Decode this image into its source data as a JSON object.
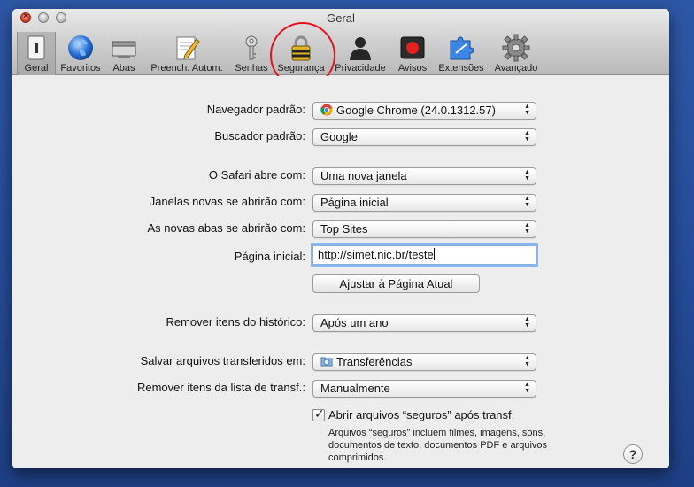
{
  "window": {
    "title": "Geral"
  },
  "toolbar": [
    {
      "label": "Geral",
      "icon": "general-switch-icon",
      "selected": true
    },
    {
      "label": "Favoritos",
      "icon": "globe-icon"
    },
    {
      "label": "Abas",
      "icon": "tabs-icon"
    },
    {
      "label": "Preench. Autom.",
      "icon": "autofill-pencil-icon"
    },
    {
      "label": "Senhas",
      "icon": "key-icon"
    },
    {
      "label": "Segurança",
      "icon": "padlock-icon"
    },
    {
      "label": "Privacidade",
      "icon": "silhouette-icon"
    },
    {
      "label": "Avisos",
      "icon": "notification-icon"
    },
    {
      "label": "Extensões",
      "icon": "puzzle-icon"
    },
    {
      "label": "Avançado",
      "icon": "gear-icon"
    }
  ],
  "form": {
    "default_browser_label": "Navegador padrão:",
    "default_browser_value": "Google Chrome (24.0.1312.57)",
    "default_search_label": "Buscador padrão:",
    "default_search_value": "Google",
    "safari_opens_label": "O Safari abre com:",
    "safari_opens_value": "Uma nova janela",
    "new_windows_label": "Janelas novas se abrirão com:",
    "new_windows_value": "Página inicial",
    "new_tabs_label": "As novas abas se abrirão com:",
    "new_tabs_value": "Top Sites",
    "homepage_label": "Página inicial:",
    "homepage_value": "http://simet.nic.br/teste",
    "set_current_button": "Ajustar à Página Atual",
    "remove_history_label": "Remover itens do histórico:",
    "remove_history_value": "Após um ano",
    "save_downloads_label": "Salvar arquivos transferidos em:",
    "save_downloads_value": "Transferências",
    "remove_downloads_label": "Remover itens da lista de transf.:",
    "remove_downloads_value": "Manualmente",
    "open_safe_files_label": "Abrir arquivos “seguros” após transf.",
    "open_safe_files_checked": true,
    "open_safe_files_help": "Arquivos “seguros” incluem filmes, imagens, sons, documentos de texto, documentos PDF e arquivos comprimidos."
  },
  "help_button": "?",
  "colors": {
    "highlight_circle": "#e4131c",
    "focus_ring": "#86b6ef"
  }
}
